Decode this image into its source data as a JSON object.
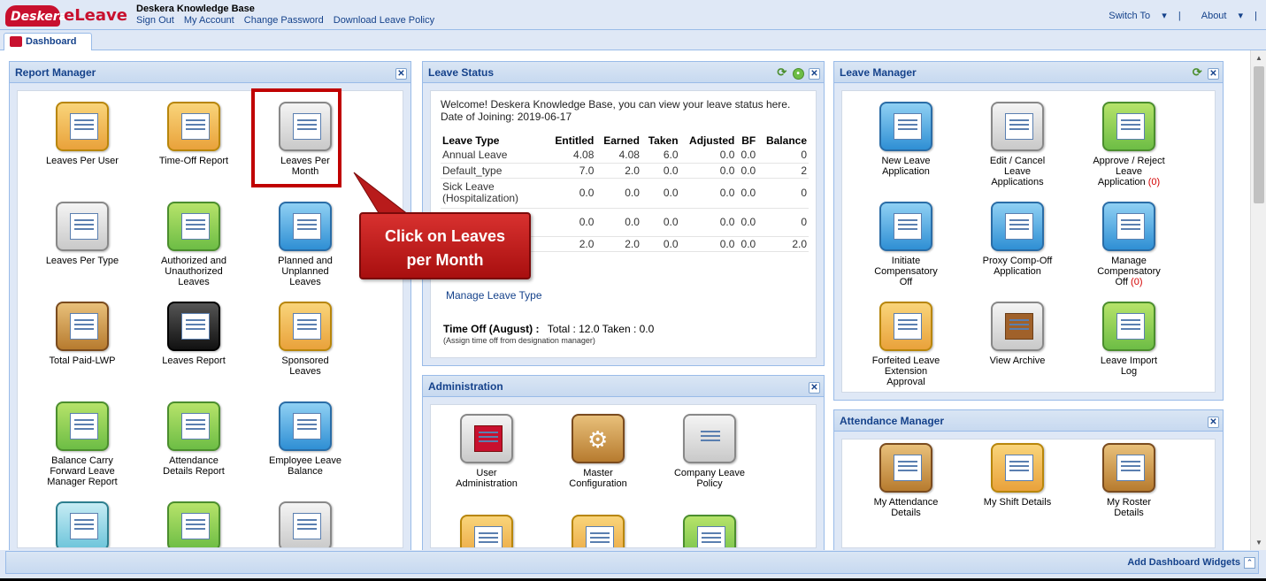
{
  "header": {
    "logo_text": "Deskera",
    "app_name": "eLeave",
    "company": "Deskera Knowledge Base",
    "links": [
      "Sign Out",
      "My Account",
      "Change Password",
      "Download Leave Policy"
    ],
    "switch_to": "Switch To",
    "about": "About"
  },
  "tabs": {
    "dashboard": "Dashboard"
  },
  "report_manager": {
    "title": "Report Manager",
    "items": [
      {
        "label": "Leaves Per User",
        "icon": "user-report-icon"
      },
      {
        "label": "Time-Off Report",
        "icon": "clock-report-icon"
      },
      {
        "label": "Leaves Per Month",
        "icon": "monthly-report-icon"
      },
      {
        "label": "Leaves Per Type",
        "icon": "type-report-icon"
      },
      {
        "label": "Authorized and Unauthorized Leaves",
        "icon": "authorized-leaves-icon"
      },
      {
        "label": "Planned and Unplanned Leaves",
        "icon": "planned-leaves-icon"
      },
      {
        "label": "Total Paid-LWP",
        "icon": "paid-lwp-icon"
      },
      {
        "label": "Leaves Report",
        "icon": "leaves-report-icon"
      },
      {
        "label": "Sponsored Leaves",
        "icon": "sponsored-leaves-icon"
      },
      {
        "label": "Balance Carry Forward Leave Manager Report",
        "icon": "carry-forward-icon"
      },
      {
        "label": "Attendance Details Report",
        "icon": "attendance-report-icon"
      },
      {
        "label": "Employee Leave Balance",
        "icon": "leave-balance-icon"
      },
      {
        "label": "",
        "icon": "user-chart-icon"
      },
      {
        "label": "",
        "icon": "calendar-team-icon"
      },
      {
        "label": "",
        "icon": "calendar-clock-icon"
      }
    ]
  },
  "leave_status": {
    "title": "Leave Status",
    "welcome": "Welcome! Deskera Knowledge Base, you can view your leave status here.",
    "doj_label": "Date of Joining:",
    "doj_value": "2019-06-17",
    "columns": [
      "Leave Type",
      "Entitled",
      "Earned",
      "Taken",
      "Adjusted",
      "BF",
      "Balance"
    ],
    "rows": [
      [
        "Annual Leave",
        "4.08",
        "4.08",
        "6.0",
        "0.0",
        "0.0",
        "0"
      ],
      [
        "Default_type",
        "7.0",
        "2.0",
        "0.0",
        "0.0",
        "0.0",
        "2"
      ],
      [
        "Sick Leave (Hospitalization)",
        "0.0",
        "0.0",
        "0.0",
        "0.0",
        "0.0",
        "0"
      ],
      [
        "",
        "0.0",
        "0.0",
        "0.0",
        "0.0",
        "0.0",
        "0"
      ],
      [
        "",
        "2.0",
        "2.0",
        "0.0",
        "0.0",
        "0.0",
        "2.0"
      ]
    ],
    "manage_link": "Manage Leave Type",
    "timeoff_label": "Time Off (August) :",
    "timeoff_value": "Total : 12.0 Taken : 0.0",
    "timeoff_note": "(Assign time off from designation manager)"
  },
  "callout": {
    "line1": "Click on Leaves",
    "line2": "per Month"
  },
  "administration": {
    "title": "Administration",
    "items": [
      {
        "label": "User Administration",
        "icon": "user-admin-icon"
      },
      {
        "label": "Master Configuration",
        "icon": "gear-icon"
      },
      {
        "label": "Company Leave Policy",
        "icon": "gavel-icon"
      },
      {
        "label": "",
        "icon": "id-card-icon"
      },
      {
        "label": "",
        "icon": "group-icon"
      },
      {
        "label": "",
        "icon": "report-card-icon"
      }
    ]
  },
  "leave_manager": {
    "title": "Leave Manager",
    "items": [
      {
        "label": "New Leave Application",
        "badge": "",
        "icon": "new-application-icon"
      },
      {
        "label": "Edit / Cancel Leave Applications",
        "badge": "",
        "icon": "edit-cancel-icon"
      },
      {
        "label": "Approve / Reject Leave Application",
        "badge": "(0)",
        "icon": "approve-reject-icon"
      },
      {
        "label": "Initiate Compensatory Off",
        "badge": "",
        "icon": "initiate-comp-off-icon"
      },
      {
        "label": "Proxy Comp-Off Application",
        "badge": "",
        "icon": "proxy-comp-off-icon"
      },
      {
        "label": "Manage Compensatory Off",
        "badge": "(0)",
        "icon": "manage-comp-off-icon"
      },
      {
        "label": "Forfeited Leave Extension Approval",
        "badge": "",
        "icon": "forfeited-leave-icon"
      },
      {
        "label": "View Archive",
        "badge": "",
        "icon": "archive-icon"
      },
      {
        "label": "Leave Import Log",
        "badge": "",
        "icon": "import-log-icon"
      }
    ]
  },
  "attendance_manager": {
    "title": "Attendance Manager",
    "items": [
      {
        "label": "My Attendance Details",
        "icon": "attendance-icon"
      },
      {
        "label": "My Shift Details",
        "icon": "shift-icon"
      },
      {
        "label": "My Roster Details",
        "icon": "roster-icon"
      }
    ]
  },
  "footer": {
    "add_widgets": "Add Dashboard Widgets"
  }
}
